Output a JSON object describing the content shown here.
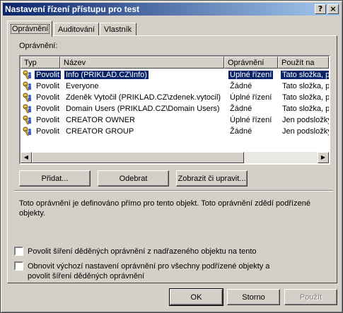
{
  "window": {
    "title": "Nastavení řízení přístupu pro test",
    "help_btn": "?",
    "close_btn": "×"
  },
  "tabs": [
    {
      "label": "Oprávnění"
    },
    {
      "label": "Auditování"
    },
    {
      "label": "Vlastník"
    }
  ],
  "permissions": {
    "label": "Oprávnění:",
    "columns": [
      "Typ",
      "Název",
      "Oprávnění",
      "Použít na"
    ],
    "rows": [
      {
        "type": "Povolit",
        "name": "Info (PRIKLAD.CZ\\Info)",
        "perm": "Úplné řízení",
        "apply": "Tato složka, p"
      },
      {
        "type": "Povolit",
        "name": "Everyone",
        "perm": "Žádné",
        "apply": "Tato složka, p"
      },
      {
        "type": "Povolit",
        "name": "Zdeněk Vytočil (PRIKLAD.CZ\\zdenek.vytocil)",
        "perm": "Úplné řízení",
        "apply": "Tato složka, p"
      },
      {
        "type": "Povolit",
        "name": "Domain Users (PRIKLAD.CZ\\Domain Users)",
        "perm": "Žádné",
        "apply": "Tato složka, p"
      },
      {
        "type": "Povolit",
        "name": "CREATOR OWNER",
        "perm": "Úplné řízení",
        "apply": "Jen podsložky"
      },
      {
        "type": "Povolit",
        "name": "CREATOR GROUP",
        "perm": "Žádné",
        "apply": "Jen podsložky"
      }
    ],
    "icon": "key-user-icon"
  },
  "buttons": {
    "add": "Přidat...",
    "remove": "Odebrat",
    "view_edit": "Zobrazit či upravit..."
  },
  "info_text": "Toto oprávnění je definováno přímo pro tento objekt. Toto oprávnění zdědí podřízené objekty.",
  "checkboxes": {
    "inherit": "Povolit šíření děděných oprávnění z nadřazeného objektu na tento",
    "reset": "Obnovit výchozí nastavení oprávnění pro všechny podřízené objekty a povolit šíření děděných oprávnění"
  },
  "dialog_buttons": {
    "ok": "OK",
    "cancel": "Storno",
    "apply": "Použít"
  },
  "colors": {
    "titlebar_start": "#0a246a",
    "titlebar_end": "#a6caf0",
    "face": "#d4d0c8",
    "selection": "#0a246a"
  }
}
